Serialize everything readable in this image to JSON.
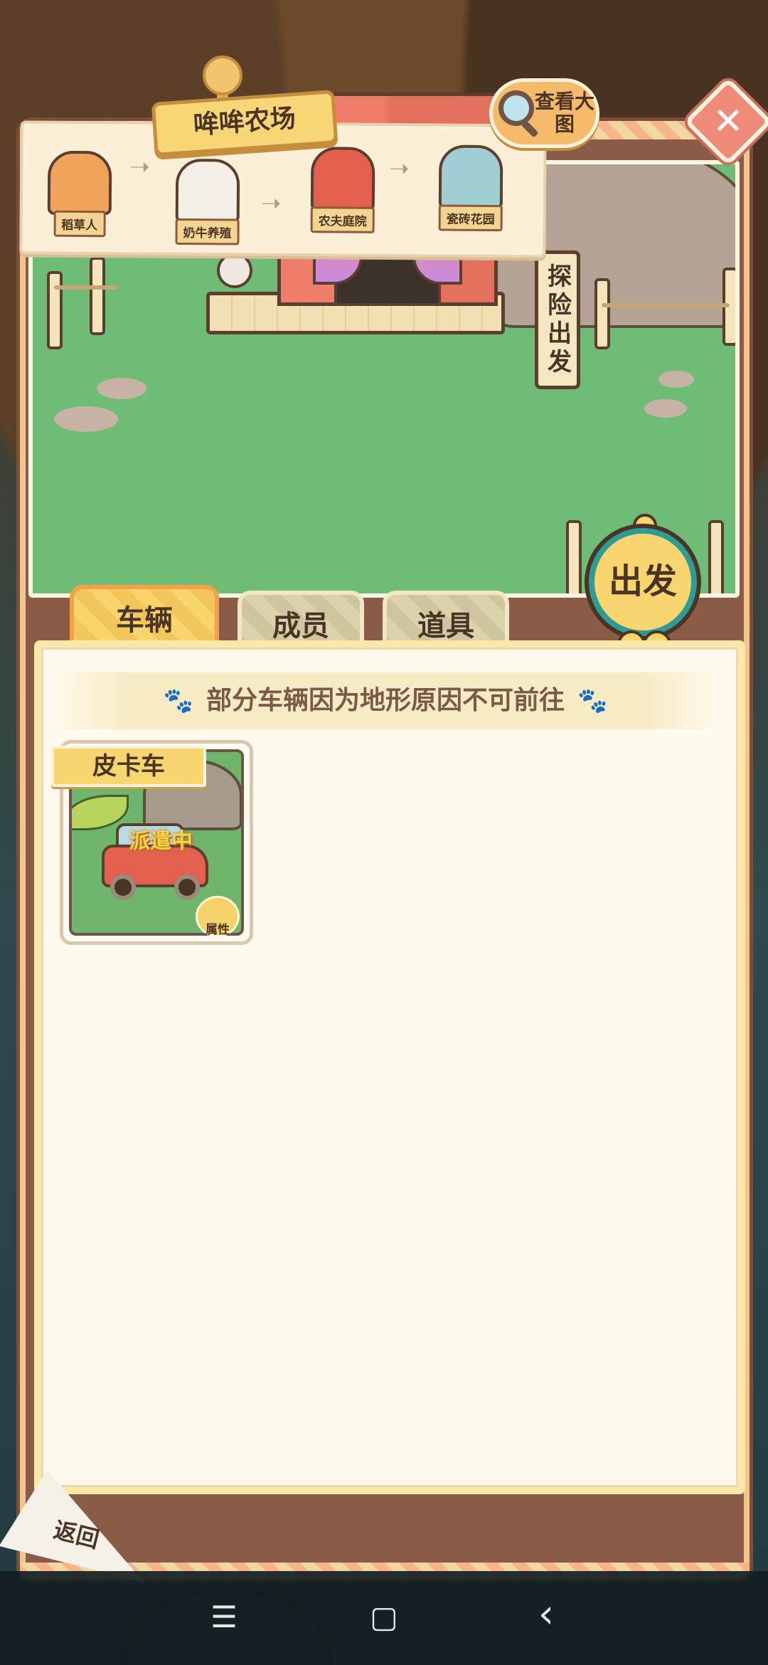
{
  "farm_board": {
    "title": "哞哞农场",
    "stages": [
      {
        "label": "稻草人",
        "icon": "scarecrow-house-icon",
        "color": "#f2a35b"
      },
      {
        "label": "奶牛养殖",
        "icon": "cow-icon",
        "color": "#f4f0e8"
      },
      {
        "label": "农夫庭院",
        "icon": "barn-icon",
        "color": "#e4604e"
      },
      {
        "label": "瓷砖花园",
        "icon": "fountain-icon",
        "color": "#9fcfd5"
      }
    ]
  },
  "zoom_button": {
    "label": "查看大图",
    "icon": "magnifier-icon"
  },
  "close_button": {
    "icon": "close-icon",
    "glyph": "✕"
  },
  "scene": {
    "sign": "探险出发"
  },
  "depart_button": {
    "label": "出发"
  },
  "tabs": [
    {
      "label": "车辆",
      "active": true
    },
    {
      "label": "成员",
      "active": false
    },
    {
      "label": "道具",
      "active": false
    }
  ],
  "notice": {
    "text": "部分车辆因为地形原因不可前往",
    "paw_glyph": "🐾"
  },
  "vehicles": [
    {
      "name": "皮卡车",
      "status": "派遣中",
      "attr_label": "属性"
    }
  ],
  "back_button": {
    "label": "返回"
  },
  "navbar": {
    "menu": "☰",
    "home": "▢",
    "back": "‹"
  },
  "colors": {
    "accent_yellow": "#f8d56e",
    "teal": "#2f9b95",
    "grass": "#6fbc77",
    "frame": "#8a5c48"
  }
}
